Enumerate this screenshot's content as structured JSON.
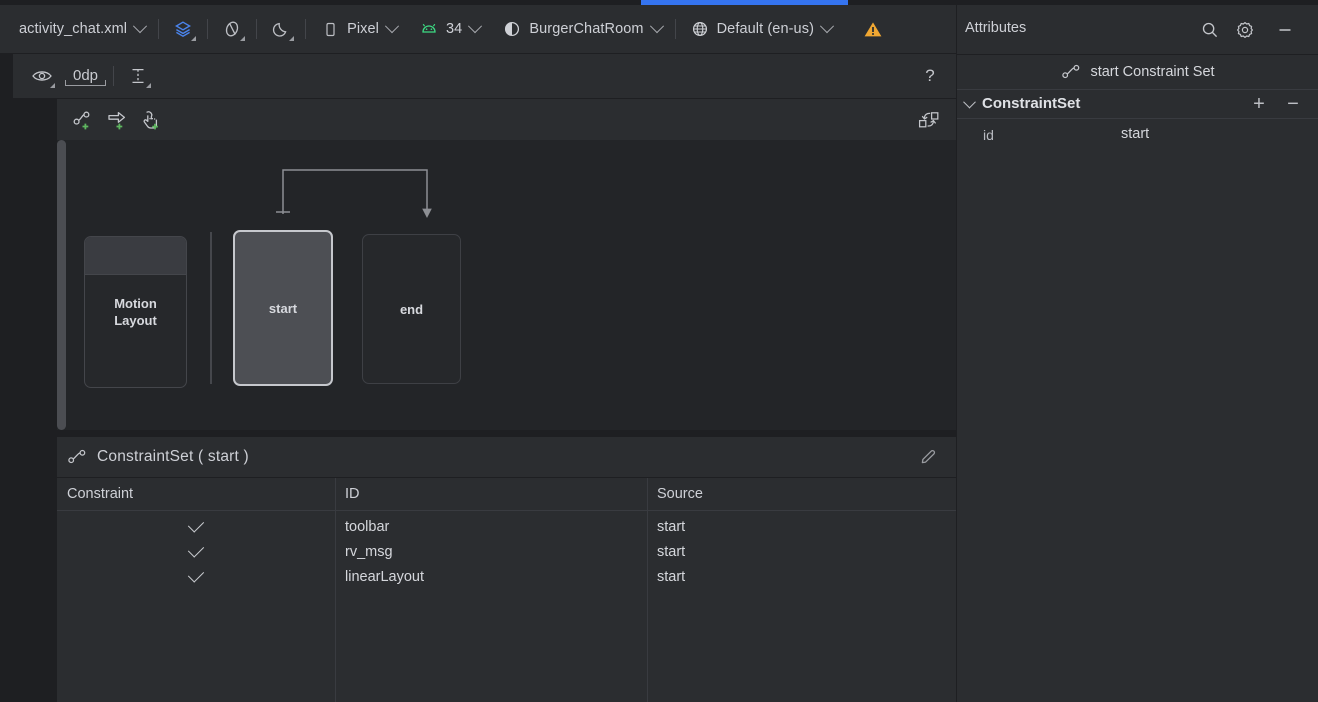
{
  "window": {
    "progress_active": true
  },
  "toolbar": {
    "file_name": "activity_chat.xml",
    "icons": [
      {
        "name": "design-views-icon",
        "label": ""
      },
      {
        "name": "rotate-3d-icon",
        "label": ""
      },
      {
        "name": "night-mode-icon",
        "label": ""
      }
    ],
    "device": "Pixel",
    "api_level": "34",
    "theme": "BurgerChatRoom",
    "locale": "Default (en-us)",
    "warning_icon": "warning-triangle-icon"
  },
  "subtoolbar": {
    "visibility_icon": "eye-icon",
    "default_margin": "0dp",
    "baseline_icon": "baseline-constraint-icon",
    "help": "?"
  },
  "motion_editor": {
    "actions": [
      {
        "name": "create-constraint-set-button"
      },
      {
        "name": "create-transition-button"
      },
      {
        "name": "create-on-click-button"
      }
    ],
    "cycle_button": "swap-constraint-sets-icon",
    "diagram": {
      "layout_box": "Motion\nLayout",
      "layout_box_line1": "Motion",
      "layout_box_line2": "Layout",
      "start_box": "start",
      "end_box": "end",
      "selected_box": "start",
      "transition_from": "start",
      "transition_to": "end"
    }
  },
  "constraint_set_panel": {
    "icon": "constraint-set-icon",
    "title": "ConstraintSet ( start )",
    "edit_icon": "pencil-icon",
    "table": {
      "columns": [
        "Constraint",
        "ID",
        "Source"
      ],
      "rows": [
        {
          "constraint": "✓",
          "id": "toolbar",
          "source": "start"
        },
        {
          "constraint": "✓",
          "id": "rv_msg",
          "source": "start"
        },
        {
          "constraint": "✓",
          "id": "linearLayout",
          "source": "start"
        }
      ]
    }
  },
  "attributes_panel": {
    "title": "Attributes",
    "search_icon": "search-icon",
    "settings_icon": "gear-icon",
    "minimize_icon": "minimize-icon",
    "selection_header": "start Constraint Set",
    "selection_header_icon": "constraint-set-icon",
    "section": {
      "name": "ConstraintSet",
      "add": "+",
      "remove": "−"
    },
    "rows": [
      {
        "key": "id",
        "value": "start"
      }
    ]
  },
  "colors": {
    "accent_blue": "#3574f0",
    "panel_bg": "#2b2d30",
    "canvas_bg": "#232528",
    "window_bg": "#1e1f22",
    "android_green": "#3ddc84",
    "warning_orange": "#f0a732",
    "selected_border": "#c6c8cd"
  }
}
